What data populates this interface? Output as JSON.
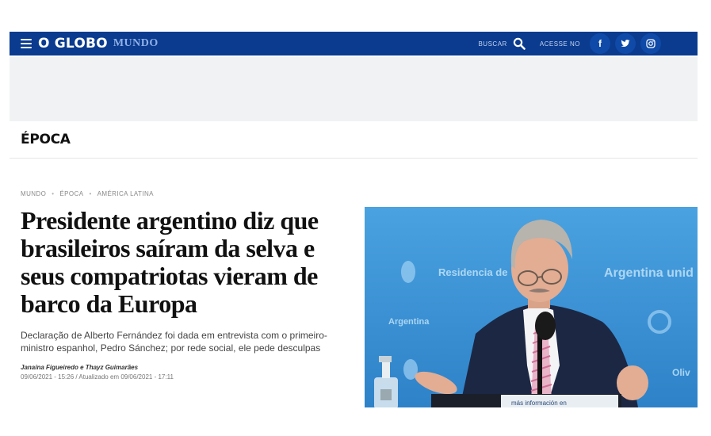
{
  "nav": {
    "logo": "O GLOBO",
    "section": "MUNDO",
    "search_label": "BUSCAR",
    "access_label": "ACESSE NO",
    "social": [
      {
        "icon": "facebook-icon",
        "glyph": "f"
      },
      {
        "icon": "twitter-icon"
      },
      {
        "icon": "instagram-icon"
      }
    ]
  },
  "brand": {
    "epoca": "ÉPOCA"
  },
  "breadcrumb": [
    "MUNDO",
    "ÉPOCA",
    "AMÉRICA LATINA"
  ],
  "article": {
    "headline": "Presidente argentino diz que brasileiros saíram da selva e seus compatriotas vieram de barco da Europa",
    "subheadline": "Declaração de Alberto Fernández foi dada em entrevista com o primeiro-ministro espanhol, Pedro Sánchez; por rede social, ele pede desculpas",
    "authors": "Janaína Figueiredo e Thayz Guimarães",
    "dates": "09/06/2021 - 15:26 / Atualizado em 09/06/2021 - 17:11"
  },
  "photo": {
    "backdrop_texts": [
      "Residencia de",
      "Argentina unid",
      "Argentina",
      "Oliv"
    ],
    "podium_text": "más información en"
  },
  "colors": {
    "nav_bg": "#0a3b8f",
    "photo_bg": "#3a90d4"
  }
}
